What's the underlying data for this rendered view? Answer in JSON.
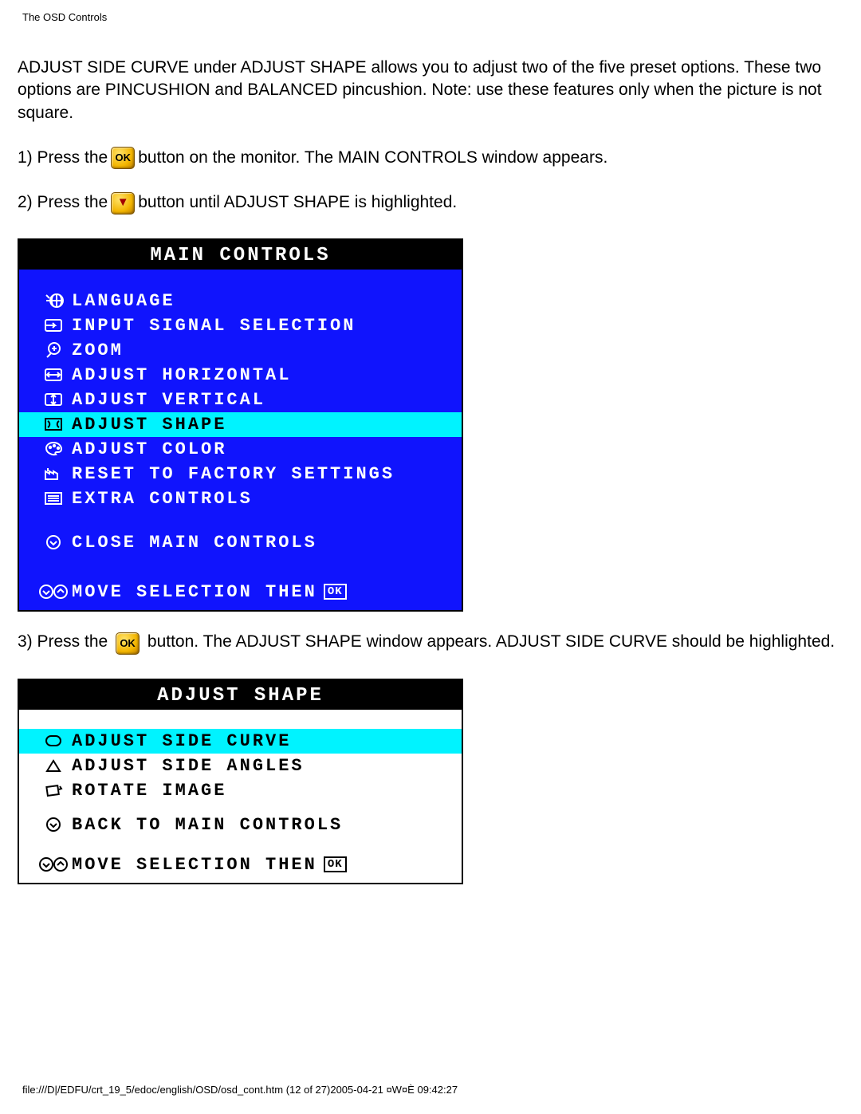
{
  "header": "The OSD Controls",
  "intro": "ADJUST SIDE CURVE under ADJUST SHAPE allows you to adjust two of the five preset options. These two options are PINCUSHION and BALANCED pincushion. Note: use these features only when the picture is not square.",
  "step1a": "1) Press the",
  "step1b": "button on the monitor. The MAIN CONTROLS window appears.",
  "step2a": "2) Press the",
  "step2b": "button until ADJUST SHAPE is highlighted.",
  "step3a": "3) Press the",
  "step3b": "button. The ADJUST SHAPE window appears. ADJUST SIDE CURVE should be highlighted.",
  "icon_ok_label": "OK",
  "osd1": {
    "title": "MAIN CONTROLS",
    "items": [
      {
        "icon": "globe",
        "label": "LANGUAGE"
      },
      {
        "icon": "input",
        "label": "INPUT SIGNAL SELECTION"
      },
      {
        "icon": "zoom",
        "label": "ZOOM"
      },
      {
        "icon": "horiz",
        "label": "ADJUST HORIZONTAL"
      },
      {
        "icon": "vert",
        "label": "ADJUST VERTICAL"
      },
      {
        "icon": "shape",
        "label": "ADJUST SHAPE",
        "hl": true
      },
      {
        "icon": "color",
        "label": "ADJUST COLOR"
      },
      {
        "icon": "reset",
        "label": "RESET TO FACTORY SETTINGS"
      },
      {
        "icon": "extra",
        "label": "EXTRA CONTROLS"
      }
    ],
    "close": "CLOSE MAIN CONTROLS",
    "footer": "MOVE SELECTION THEN",
    "footer_ok": "OK"
  },
  "osd2": {
    "title": "ADJUST SHAPE",
    "items": [
      {
        "icon": "sidecurve",
        "label": "ADJUST SIDE CURVE",
        "hl": true
      },
      {
        "icon": "sideangle",
        "label": "ADJUST SIDE ANGLES"
      },
      {
        "icon": "rotate",
        "label": "ROTATE IMAGE"
      }
    ],
    "back": "BACK TO MAIN CONTROLS",
    "footer": "MOVE SELECTION THEN",
    "footer_ok": "OK"
  },
  "page_footer": "file:///D|/EDFU/crt_19_5/edoc/english/OSD/osd_cont.htm (12 of 27)2005-04-21 ¤W¤È 09:42:27"
}
